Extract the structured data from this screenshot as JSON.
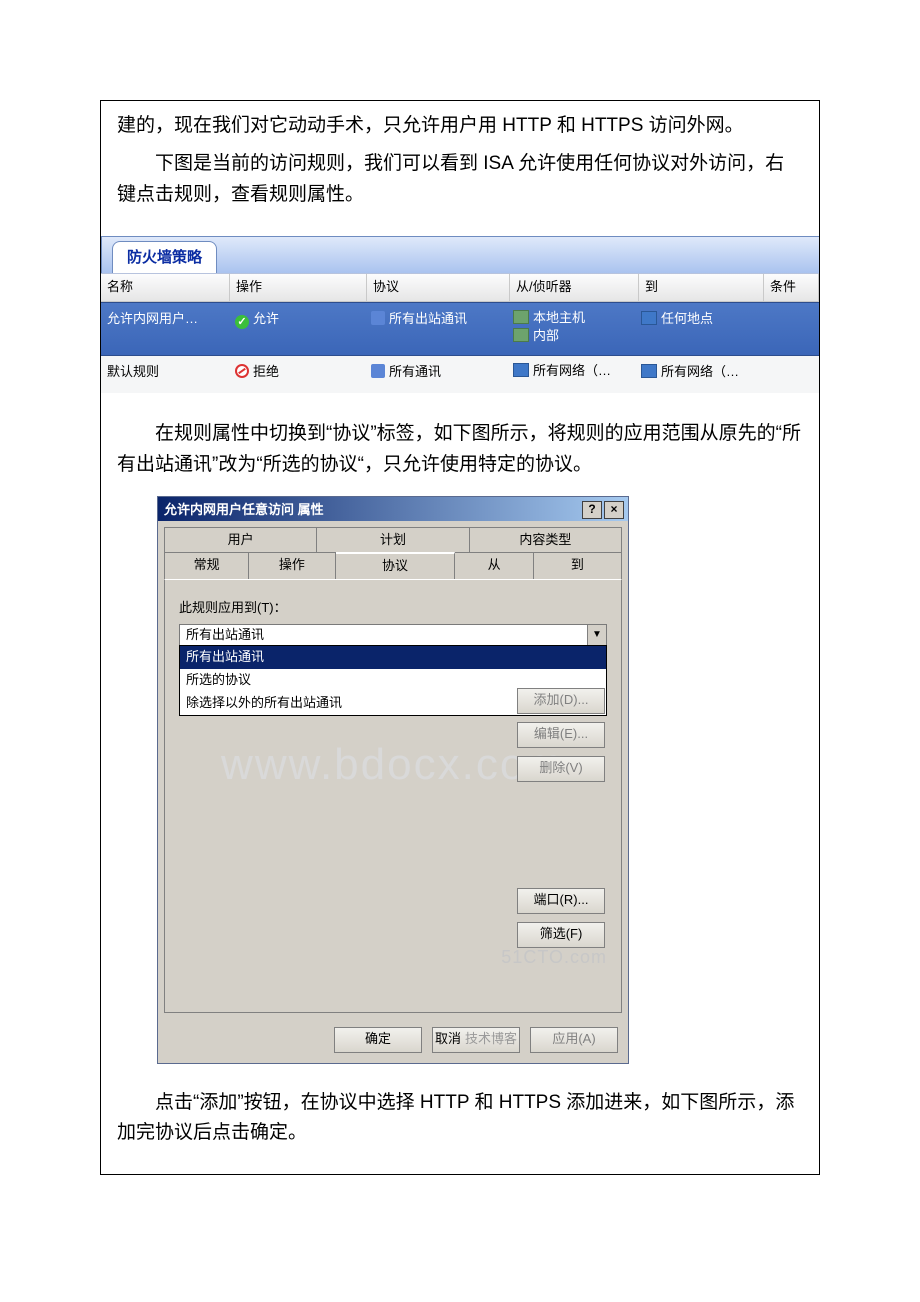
{
  "paragraphs": {
    "p0": "建的，现在我们对它动动手术，只允许用户用 HTTP 和 HTTPS 访问外网。",
    "p1": "下图是当前的访问规则，我们可以看到 ISA 允许使用任何协议对外访问，右键点击规则，查看规则属性。",
    "p2": "在规则属性中切换到“协议”标签，如下图所示，将规则的应用范围从原先的“所有出站通讯”改为“所选的协议“，只允许使用特定的协议。",
    "p3": "点击“添加”按钮，在协议中选择 HTTP 和 HTTPS 添加进来，如下图所示，添加完协议后点击确定。"
  },
  "firewall": {
    "tab_label": "防火墙策略",
    "headers": {
      "name": "名称",
      "action": "操作",
      "protocol": "协议",
      "from": "从/侦听器",
      "to": "到",
      "cond": "条件"
    },
    "rows": [
      {
        "name": "允许内网用户…",
        "action": "允许",
        "protocol": "所有出站通讯",
        "from_lines": [
          "本地主机",
          "内部"
        ],
        "to": "任何地点",
        "selected": true
      },
      {
        "name": "默认规则",
        "action": "拒绝",
        "protocol": "所有通讯",
        "from_lines": [
          "所有网络（…"
        ],
        "to": "所有网络（…",
        "selected": false
      }
    ]
  },
  "dialog": {
    "title": "允许内网用户任意访问 属性",
    "help_btn": "?",
    "close_btn": "×",
    "tabs_row1": [
      "用户",
      "计划",
      "内容类型"
    ],
    "tabs_row2": [
      "常规",
      "操作",
      "协议",
      "从",
      "到"
    ],
    "active_tab": "协议",
    "apply_to_label": "此规则应用到(T)：",
    "combo_value": "所有出站通讯",
    "dropdown_options": [
      "所有出站通讯",
      "所选的协议",
      "除选择以外的所有出站通讯"
    ],
    "buttons": {
      "add": "添加(D)...",
      "edit": "编辑(E)...",
      "remove": "删除(V)",
      "ports": "端口(R)...",
      "filter": "筛选(F)"
    },
    "ok": "确定",
    "cancel": "取消",
    "apply": "应用(A)"
  },
  "watermarks": {
    "big": "www.bdocx.com",
    "small": "51CTO.com",
    "footer": "技术博客"
  }
}
